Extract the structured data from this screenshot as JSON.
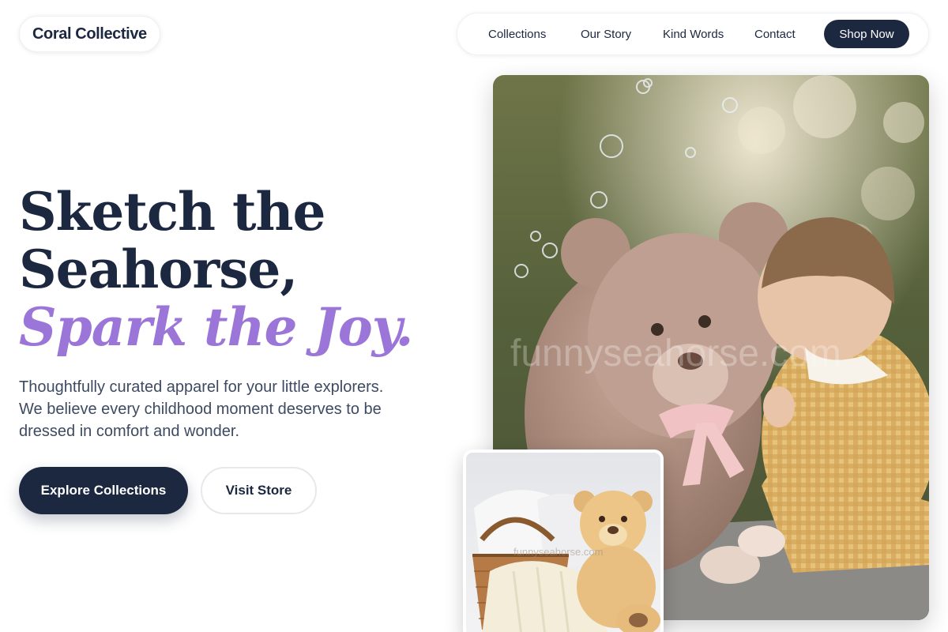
{
  "header": {
    "brand": "Coral Collective",
    "nav": {
      "collections": "Collections",
      "our_story": "Our Story",
      "kind_words": "Kind Words",
      "contact": "Contact"
    },
    "shop_now": "Shop Now"
  },
  "hero": {
    "title_line1": "Sketch the",
    "title_line2": "Seahorse,",
    "title_accent": "Spark the Joy.",
    "subtitle_line1": "Thoughtfully curated apparel for your little explorers.",
    "subtitle_line2": "We believe every childhood moment deserves to be",
    "subtitle_line3": "dressed in comfort and wonder.",
    "primary_cta": "Explore Collections",
    "secondary_cta": "Visit Store"
  },
  "images": {
    "main_watermark": "funnyseahorse.com",
    "inset_watermark": "funnyseahorse.com"
  },
  "colors": {
    "navy": "#1c2740",
    "accent_purple": "#9b76d8",
    "body_text": "#3d4a62"
  }
}
